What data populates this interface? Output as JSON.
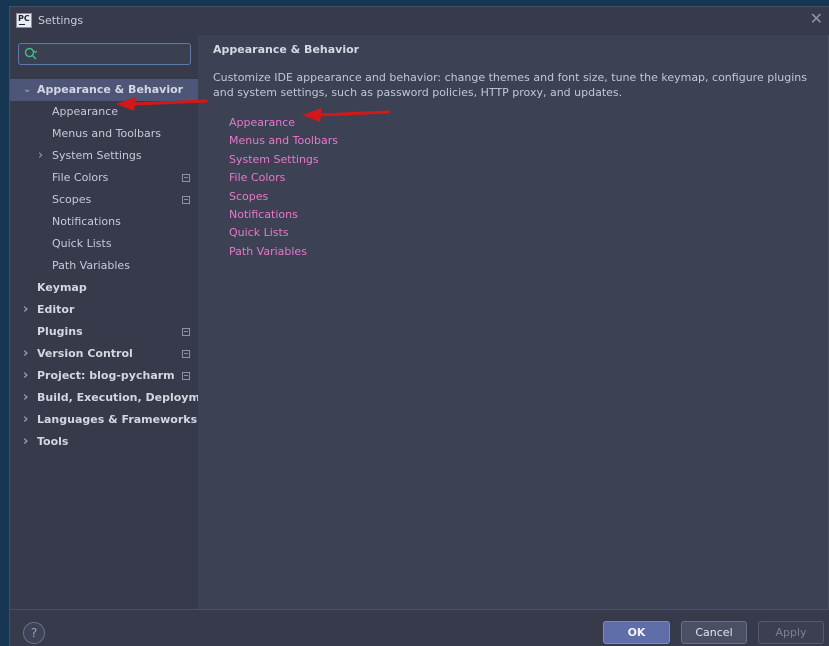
{
  "window": {
    "title": "Settings",
    "logo_text": "PC"
  },
  "search": {
    "placeholder": "",
    "value": ""
  },
  "sidebar": {
    "items": [
      {
        "label": "Appearance & Behavior",
        "level": 0,
        "expanded": true,
        "bold": true,
        "selected": true
      },
      {
        "label": "Appearance",
        "level": 1
      },
      {
        "label": "Menus and Toolbars",
        "level": 1
      },
      {
        "label": "System Settings",
        "level": 1,
        "collapsed": true
      },
      {
        "label": "File Colors",
        "level": 1,
        "modified": true
      },
      {
        "label": "Scopes",
        "level": 1,
        "modified": true
      },
      {
        "label": "Notifications",
        "level": 1
      },
      {
        "label": "Quick Lists",
        "level": 1
      },
      {
        "label": "Path Variables",
        "level": 1
      },
      {
        "label": "Keymap",
        "level": 0,
        "bold": true
      },
      {
        "label": "Editor",
        "level": 0,
        "bold": true,
        "collapsed": true
      },
      {
        "label": "Plugins",
        "level": 0,
        "bold": true,
        "modified": true
      },
      {
        "label": "Version Control",
        "level": 0,
        "bold": true,
        "collapsed": true,
        "modified": true
      },
      {
        "label": "Project: blog-pycharm",
        "level": 0,
        "bold": true,
        "collapsed": true,
        "modified": true
      },
      {
        "label": "Build, Execution, Deployment",
        "level": 0,
        "bold": true,
        "collapsed": true
      },
      {
        "label": "Languages & Frameworks",
        "level": 0,
        "bold": true,
        "collapsed": true
      },
      {
        "label": "Tools",
        "level": 0,
        "bold": true,
        "collapsed": true
      }
    ]
  },
  "content": {
    "title": "Appearance & Behavior",
    "description": "Customize IDE appearance and behavior: change themes and font size, tune the keymap, configure plugins and system settings, such as password policies, HTTP proxy, and updates.",
    "links": [
      "Appearance",
      "Menus and Toolbars",
      "System Settings",
      "File Colors",
      "Scopes",
      "Notifications",
      "Quick Lists",
      "Path Variables"
    ]
  },
  "footer": {
    "help_label": "?",
    "ok_label": "OK",
    "cancel_label": "Cancel",
    "apply_label": "Apply"
  },
  "colors": {
    "link": "#e978cb",
    "selection": "#4e5678",
    "annotation_arrow": "#d41818"
  }
}
